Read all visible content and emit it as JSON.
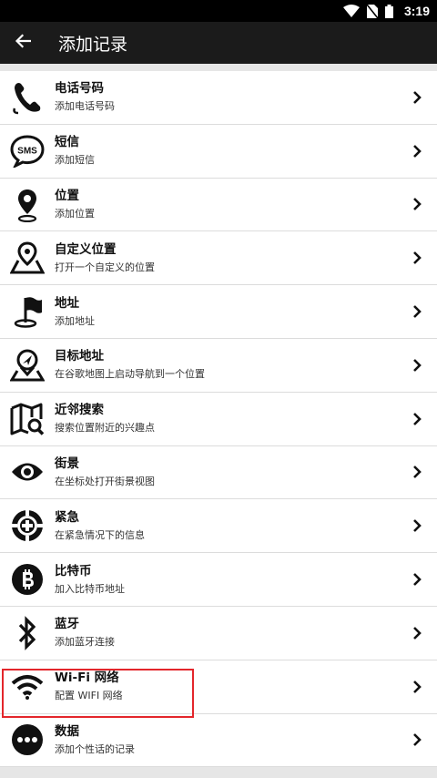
{
  "status_bar": {
    "time": "3:19"
  },
  "app_bar": {
    "title": "添加记录"
  },
  "items": [
    {
      "title": "电话号码",
      "subtitle": "添加电话号码",
      "icon": "phone-icon"
    },
    {
      "title": "短信",
      "subtitle": "添加短信",
      "icon": "sms-icon",
      "icon_text": "SMS"
    },
    {
      "title": "位置",
      "subtitle": "添加位置",
      "icon": "location-pin-icon"
    },
    {
      "title": "自定义位置",
      "subtitle": "打开一个自定义的位置",
      "icon": "map-pin-icon"
    },
    {
      "title": "地址",
      "subtitle": "添加地址",
      "icon": "flag-icon"
    },
    {
      "title": "目标地址",
      "subtitle": "在谷歌地图上启动导航到一个位置",
      "icon": "navigation-icon"
    },
    {
      "title": "近邻搜索",
      "subtitle": "搜索位置附近的兴趣点",
      "icon": "map-search-icon"
    },
    {
      "title": "街景",
      "subtitle": "在坐标处打开街景视图",
      "icon": "eye-icon"
    },
    {
      "title": "紧急",
      "subtitle": "在紧急情况下的信息",
      "icon": "emergency-icon"
    },
    {
      "title": "比特币",
      "subtitle": "加入比特币地址",
      "icon": "bitcoin-icon"
    },
    {
      "title": "蓝牙",
      "subtitle": "添加蓝牙连接",
      "icon": "bluetooth-icon"
    },
    {
      "title": "Wi-Fi 网络",
      "subtitle": "配置 WIFI 网络",
      "icon": "wifi-icon"
    },
    {
      "title": "数据",
      "subtitle": "添加个性话的记录",
      "icon": "more-dots-icon"
    }
  ],
  "colors": {
    "highlight": "#e3262b",
    "app_bar": "#1b1b1b",
    "status_bar": "#000000"
  }
}
